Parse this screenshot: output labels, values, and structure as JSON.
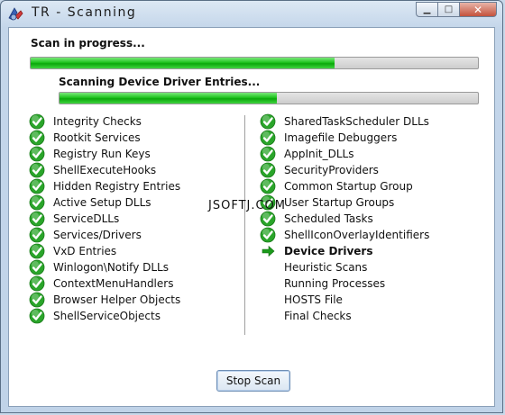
{
  "window": {
    "title": "TR  - Scanning",
    "minimize_icon": "minimize-icon",
    "maximize_icon": "maximize-icon",
    "close_icon": "close-icon"
  },
  "status": {
    "main_text": "Scan in progress...",
    "main_progress": 0.68,
    "sub_text": "Scanning Device Driver Entries...",
    "sub_progress": 0.52
  },
  "left_items": [
    {
      "label": "Integrity Checks",
      "state": "done"
    },
    {
      "label": "Rootkit Services",
      "state": "done"
    },
    {
      "label": "Registry Run Keys",
      "state": "done"
    },
    {
      "label": "ShellExecuteHooks",
      "state": "done"
    },
    {
      "label": "Hidden Registry Entries",
      "state": "done"
    },
    {
      "label": "Active Setup DLLs",
      "state": "done"
    },
    {
      "label": "ServiceDLLs",
      "state": "done"
    },
    {
      "label": "Services/Drivers",
      "state": "done"
    },
    {
      "label": "VxD Entries",
      "state": "done"
    },
    {
      "label": "Winlogon\\Notify DLLs",
      "state": "done"
    },
    {
      "label": "ContextMenuHandlers",
      "state": "done"
    },
    {
      "label": "Browser Helper Objects",
      "state": "done"
    },
    {
      "label": "ShellServiceObjects",
      "state": "done"
    }
  ],
  "right_items": [
    {
      "label": "SharedTaskScheduler DLLs",
      "state": "done"
    },
    {
      "label": "Imagefile Debuggers",
      "state": "done"
    },
    {
      "label": "AppInit_DLLs",
      "state": "done"
    },
    {
      "label": "SecurityProviders",
      "state": "done"
    },
    {
      "label": "Common Startup Group",
      "state": "done"
    },
    {
      "label": "User Startup Groups",
      "state": "done"
    },
    {
      "label": "Scheduled Tasks",
      "state": "done"
    },
    {
      "label": "ShellIconOverlayIdentifiers",
      "state": "done"
    },
    {
      "label": "Device Drivers",
      "state": "current"
    },
    {
      "label": "Heuristic Scans",
      "state": "pending"
    },
    {
      "label": "Running Processes",
      "state": "pending"
    },
    {
      "label": "HOSTS File",
      "state": "pending"
    },
    {
      "label": "Final Checks",
      "state": "pending"
    }
  ],
  "watermark": "JSOFTJ.COM",
  "buttons": {
    "stop_label": "Stop Scan"
  },
  "colors": {
    "check_green": "#2aa52a",
    "progress_green": "#1fc41f",
    "arrow_green": "#1c9a1c"
  }
}
